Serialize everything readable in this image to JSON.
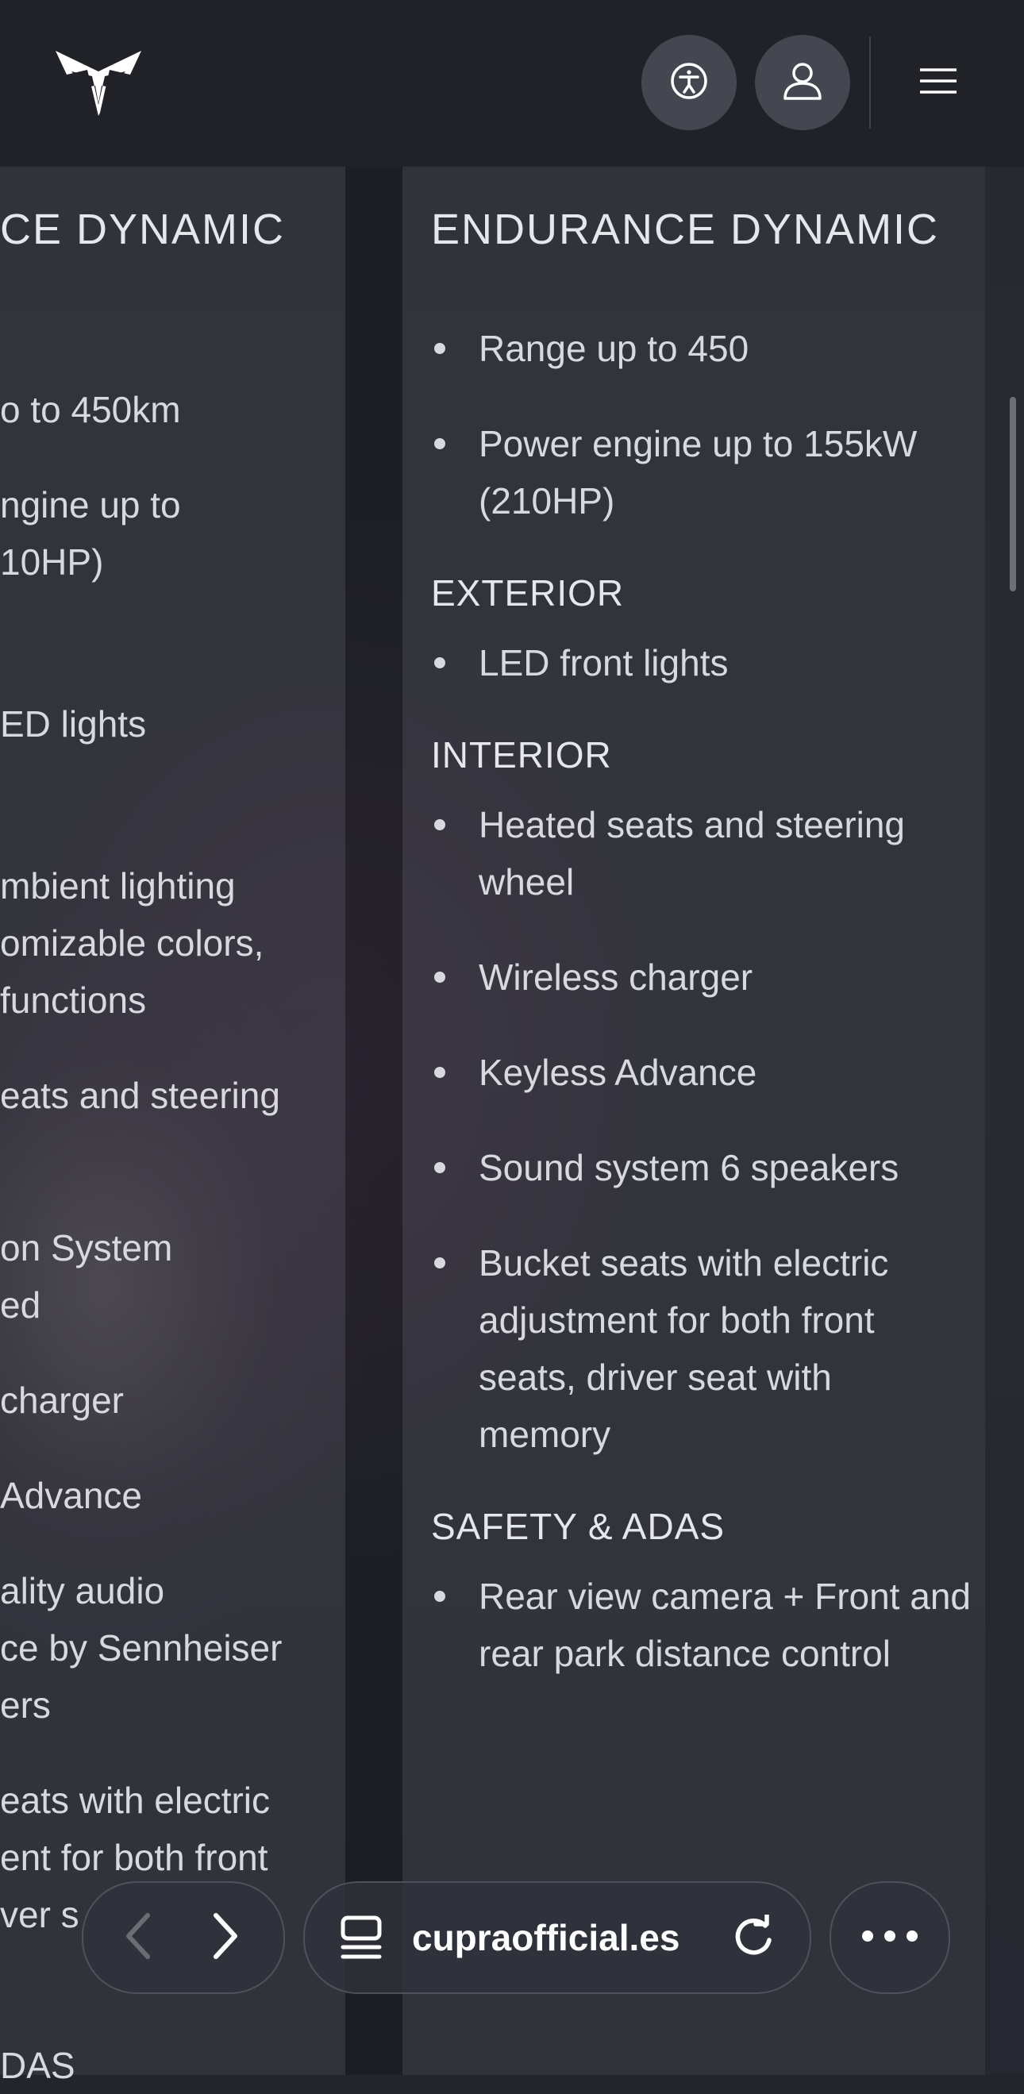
{
  "header": {
    "logo": "cupra-logo",
    "accessibility_icon": "accessibility-icon",
    "account_icon": "user-icon",
    "menu_icon": "hamburger-menu-icon"
  },
  "left_column": {
    "title_fragment": "CE DYNAMIC",
    "fragments": [
      "o to 450km",
      "ngine  up to",
      "10HP)",
      "ED  lights",
      "mbient lighting",
      "omizable colors,",
      " functions",
      "eats and steering",
      "on System",
      "ed",
      "charger",
      "Advance",
      "ality audio",
      "ce by Sennheiser",
      "ers",
      "eats with electric",
      "ent for both front",
      "ver s",
      "DAS"
    ]
  },
  "right_column": {
    "title": "ENDURANCE DYNAMIC",
    "performance": [
      "Range up to 450",
      "Power engine up to 155kW (210HP)"
    ],
    "exterior_heading": "EXTERIOR",
    "exterior": [
      "LED front lights"
    ],
    "interior_heading": "INTERIOR",
    "interior": [
      "Heated seats and steering wheel",
      "Wireless charger",
      "Keyless Advance",
      "Sound system 6 speakers",
      "Bucket seats with electric adjustment for both front seats, driver seat with memory"
    ],
    "safety_heading": "SAFETY & ADAS",
    "safety": [
      "Rear view camera + Front and rear park distance control"
    ]
  },
  "browser_bar": {
    "back_icon": "chevron-left-icon",
    "forward_icon": "chevron-right-icon",
    "tabs_icon": "tab-overview-icon",
    "url": "cupraofficial.es",
    "reload_icon": "reload-icon",
    "more_icon": "more-dots-icon"
  },
  "colors": {
    "background": "#23252b",
    "header": "#202228",
    "text": "#d7d9de"
  }
}
